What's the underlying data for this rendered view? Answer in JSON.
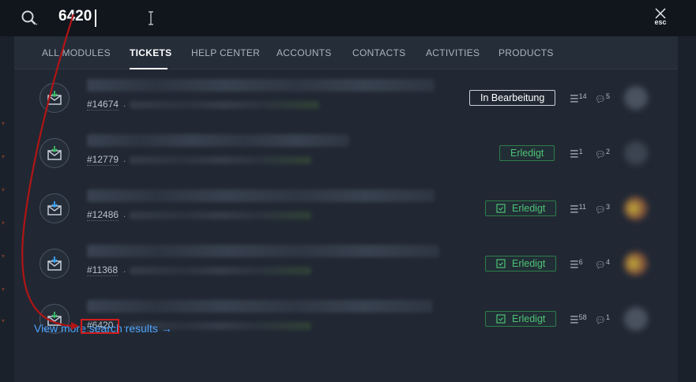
{
  "search": {
    "value": "6420",
    "close_label": "esc"
  },
  "tabs": [
    {
      "label": "ALL MODULES",
      "active": false
    },
    {
      "label": "TICKETS",
      "active": true
    },
    {
      "label": "HELP CENTER",
      "active": false
    },
    {
      "label": "ACCOUNTS",
      "active": false
    },
    {
      "label": "CONTACTS",
      "active": false
    },
    {
      "label": "ACTIVITIES",
      "active": false
    },
    {
      "label": "PRODUCTS",
      "active": false
    }
  ],
  "results": [
    {
      "id": "#14674",
      "status": "In Bearbeitung",
      "threads": "14",
      "comments": "5"
    },
    {
      "id": "#12779",
      "status": "Erledigt",
      "threads": "1",
      "comments": "2"
    },
    {
      "id": "#12486",
      "status": "Erledigt",
      "threads": "11",
      "comments": "3"
    },
    {
      "id": "#11368",
      "status": "Erledigt",
      "threads": "6",
      "comments": "4"
    },
    {
      "id": "#6420",
      "status": "Erledigt",
      "threads": "58",
      "comments": "1"
    }
  ],
  "view_more": "View more search results →",
  "colors": {
    "accent_link": "#4da3ff",
    "status_done": "#4cc276",
    "highlight": "#d21d1d"
  },
  "icons": {
    "search": "search-icon",
    "close": "close-icon",
    "mail": "mail-icon",
    "threads": "threads-icon",
    "comments": "comment-icon"
  }
}
